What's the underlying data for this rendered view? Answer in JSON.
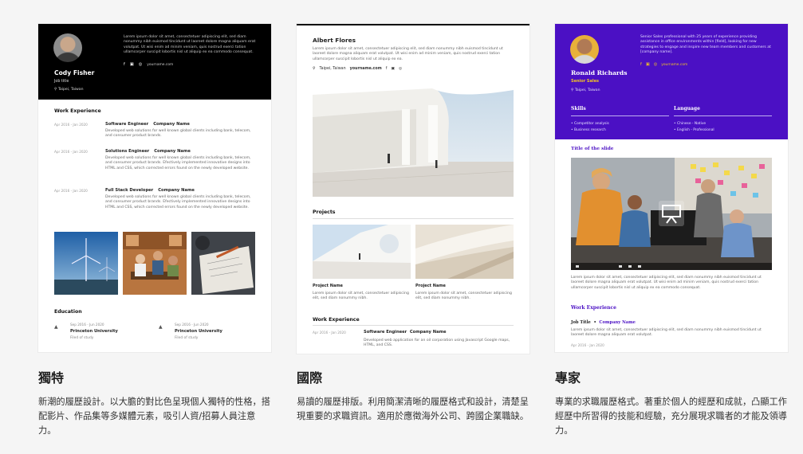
{
  "colors": {
    "page_bg": "#f5f5f5",
    "card3_accent": "#4b10c4",
    "card3_highlight": "#f3c323"
  },
  "card1": {
    "name": "Cody Fisher",
    "job_title": "Job title",
    "location": "Taipei, Taiwan",
    "summary": "Lorem ipsum dolor sit amet, consectetuer adipiscing elit, sed diam nonummy nibh euismod tincidunt ut laoreet dolore magna aliquam erat volutpat. Ut wisi enim ad minim veniam, quis nostrud exerci tation ullamcorper suscipit lobortis nisl ut aliquip ex ea commodo consequat.",
    "website": "yourname.com",
    "section_experience": "Work Experience",
    "experience": [
      {
        "date": "Apr 2016 - Jan 2020",
        "role": "Software Engineer",
        "company": "Company Name",
        "desc": "Developed web solutions for well known global clients including bank, telecom, and consumer product brands."
      },
      {
        "date": "Apr 2016 - Jan 2020",
        "role": "Solutions Engineer",
        "company": "Company Name",
        "desc": "Developed web solutions for well known global clients including bank, telecom, and consumer product brands. Efectively implemented innovative designs into HTML and CSS, which corrected errors found on the newly developed website."
      },
      {
        "date": "Apr 2016 - Jan 2020",
        "role": "Full Stack Developer",
        "company": "Company Name",
        "desc": "Developed web solutions for well known global clients including bank, telecom, and consumer product brands. Efectively implemented innovative designs into HTML and CSS, which corrected errors found on the newly developed website."
      }
    ],
    "section_education": "Education",
    "education": [
      {
        "date": "Sep 2016 - Jun 2020",
        "school": "Princeton University",
        "field": "Filed of study"
      },
      {
        "date": "Sep 2016 - Jun 2020",
        "school": "Princeton University",
        "field": "Filed of study"
      }
    ]
  },
  "card2": {
    "name": "Albert Flores",
    "intro": "Lorem ipsum dolor sit amet, consectetuer adipiscing elit, sed diam nonummy nibh euismod tincidunt ut laoreet dolore magna aliquam erat volutpat. Ut wisi enim ad minim veniam, quis nostrud exerci tation ullamcorper suscipit lobortis nisl ut aliquip ex ea.",
    "location": "Taipei, Taiwan",
    "website": "yourname.com",
    "section_projects": "Projects",
    "projects": [
      {
        "title": "Project Name",
        "desc": "Lorem ipsum dolor sit amet, consectetuer adipiscing elit, sed diam nonummy nibh."
      },
      {
        "title": "Project Name",
        "desc": "Lorem ipsum dolor sit amet, consectetuer adipiscing elit, sed diam nonummy nibh."
      }
    ],
    "section_experience": "Work Experience",
    "experience": {
      "date": "Apr 2016 - Jan 2020",
      "role": "Software Engineer",
      "company": "Company Name",
      "desc": "Developed web application for an oil corporation using Javascript Google maps, HTML, and CSS."
    }
  },
  "card3": {
    "name": "Ronald Richards",
    "title": "Senior Sales",
    "location": "Taipei, Taiwan",
    "summary": "Senior Sales professional with 25 years of experience providing assistance in office environments within [field], looking for new strategies to engage and inspire new team members and customers at [company name].",
    "website": "yourname.com",
    "skills_heading": "Skills",
    "skills": [
      "Competitor analysis",
      "Business research"
    ],
    "language_heading": "Language",
    "languages": [
      "Chinese - Native",
      "English - Professional"
    ],
    "slide_title": "Title of the slide",
    "slide_desc": "Lorem ipsum dolor sit amet, consectetuer adipiscing elit, sed diam nonummy nibh euismod tincidunt ut laoreet dolore magna aliquam erat volutpat. Ut wisi enim ad minim veniam, quis nostrud exerci tation ullamcorper suscipit lobortis nisl ut aliquip ex ea commodo consequat.",
    "section_experience": "Work Experience",
    "job_title": "Job Title",
    "job_company": "Company Name",
    "job_desc": "Lorem ipsum dolor sit amet, consectetuer adipiscing elit, sed diam nonummy nibh euismod tincidunt ut laoreet dolore magna aliquam erat volutpat.",
    "job_date": "Apr 2016 - Jan 2020"
  },
  "captions": [
    {
      "title": "獨特",
      "desc": "新潮的履歷設計。以大膽的對比色呈現個人獨特的性格，搭配影片、作品集等多媒體元素，吸引人資/招募人員注意力。"
    },
    {
      "title": "國際",
      "desc": "易讀的履歷排版。利用簡潔清晰的履歷格式和設計，清楚呈現重要的求職資訊。適用於應徵海外公司、跨國企業職缺。"
    },
    {
      "title": "專家",
      "desc": "專業的求職履歷格式。著重於個人的經歷和成就，凸顯工作經歷中所習得的技能和經驗，充分展現求職者的才能及領導力。"
    }
  ]
}
